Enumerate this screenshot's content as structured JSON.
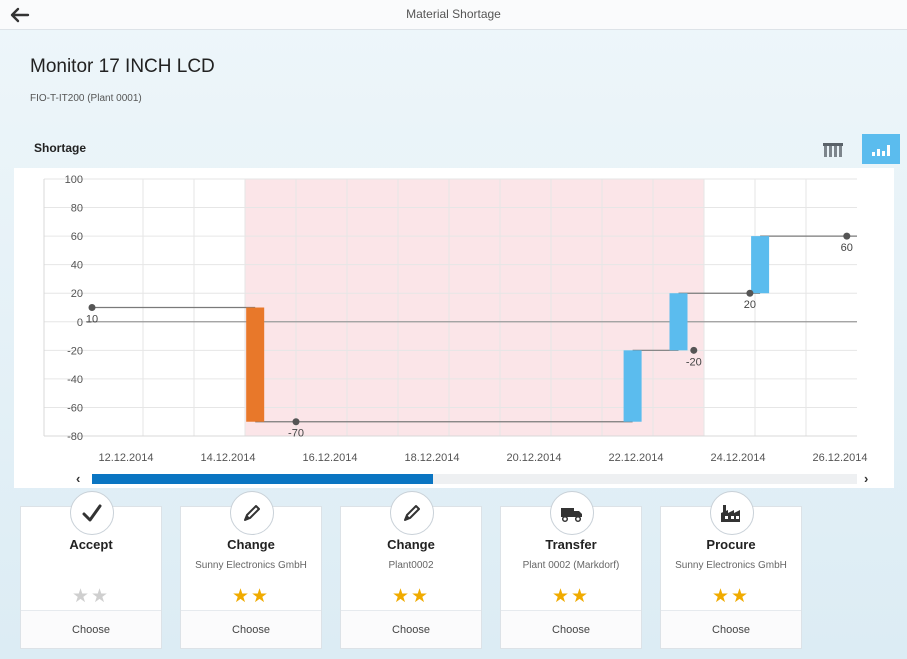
{
  "header": {
    "title": "Material Shortage"
  },
  "object": {
    "title": "Monitor 17 INCH LCD",
    "subtitle": "FIO-T-IT200 (Plant 0001)"
  },
  "section": {
    "label": "Shortage"
  },
  "colors": {
    "shortage_bar": "#e8782a",
    "supply_bar": "#5bbcee",
    "highlight_band": "#fbe5e8",
    "accent": "#0a75c2",
    "star": "#f0ab00"
  },
  "icons": {
    "back": "arrow-left-icon",
    "table_view": "table-view-icon",
    "chart_view": "bar-chart-icon",
    "accept": "checkmark-icon",
    "change": "pencil-icon",
    "transfer": "truck-icon",
    "procure": "factory-icon"
  },
  "chart_data": {
    "type": "bar",
    "ylim": [
      -80,
      100
    ],
    "yticks": [
      -80,
      -60,
      -40,
      -20,
      0,
      20,
      40,
      60,
      80,
      100
    ],
    "xlim": [
      "2014-12-12",
      "2014-12-27"
    ],
    "xticks": [
      "12.12.2014",
      "14.12.2014",
      "16.12.2014",
      "18.12.2014",
      "20.12.2014",
      "22.12.2014",
      "24.12.2014",
      "26.12.2014"
    ],
    "highlight_range": [
      "2014-12-15",
      "2014-12-24"
    ],
    "grid": true,
    "steps": [
      {
        "from": "2014-12-12",
        "to": "2014-12-15.2",
        "value": 10
      },
      {
        "from": "2014-12-15.2",
        "to": "2014-12-22.6",
        "value": -70
      },
      {
        "from": "2014-12-22.6",
        "to": "2014-12-23.5",
        "value": -20
      },
      {
        "from": "2014-12-23.5",
        "to": "2014-12-25.1",
        "value": 20
      },
      {
        "from": "2014-12-25.1",
        "to": "2014-12-27",
        "value": 60
      }
    ],
    "bars": [
      {
        "date": "2014-12-15.2",
        "from": 10,
        "to": -70,
        "kind": "shortage"
      },
      {
        "date": "2014-12-22.6",
        "from": -70,
        "to": -20,
        "kind": "supply"
      },
      {
        "date": "2014-12-23.5",
        "from": -20,
        "to": 20,
        "kind": "supply"
      },
      {
        "date": "2014-12-25.1",
        "from": 20,
        "to": 60,
        "kind": "supply"
      }
    ],
    "points": [
      {
        "date": "2014-12-12",
        "value": 10,
        "label": "10"
      },
      {
        "date": "2014-12-16",
        "value": -70,
        "label": "-70"
      },
      {
        "date": "2014-12-23.8",
        "value": -20,
        "label": "-20"
      },
      {
        "date": "2014-12-24.9",
        "value": 20,
        "label": "20"
      },
      {
        "date": "2014-12-26.8",
        "value": 60,
        "label": "60"
      }
    ],
    "scroll_thumb_fraction": 0.446
  },
  "cards": [
    {
      "title": "Accept",
      "desc": "",
      "stars": 0,
      "max_stars": 2,
      "action": "Choose"
    },
    {
      "title": "Change",
      "desc": "Sunny Electronics GmbH",
      "stars": 2,
      "max_stars": 2,
      "action": "Choose"
    },
    {
      "title": "Change",
      "desc": "Plant0002",
      "stars": 2,
      "max_stars": 2,
      "action": "Choose"
    },
    {
      "title": "Transfer",
      "desc": "Plant 0002 (Markdorf)",
      "stars": 2,
      "max_stars": 2,
      "action": "Choose"
    },
    {
      "title": "Procure",
      "desc": "Sunny Electronics GmbH",
      "stars": 2,
      "max_stars": 2,
      "action": "Choose"
    }
  ]
}
